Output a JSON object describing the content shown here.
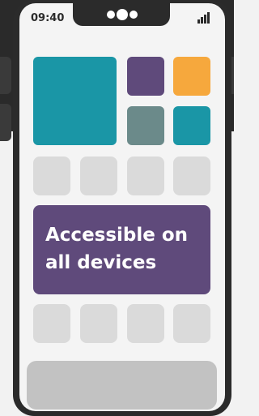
{
  "status_bar": {
    "time": "09:40",
    "signal_icon": "cellular-signal-icon",
    "notch_icon": "camera-notch-icon"
  },
  "tiles": {
    "large_color": "#1a96a6",
    "small_colors": [
      "#5f4a7b",
      "#f6a83d",
      "#6b8a8a",
      "#1a96a6"
    ]
  },
  "placeholder_color": "#dadada",
  "banner": {
    "text_line1": "Accessible on",
    "text_line2": "all devices",
    "color": "#5f4a7b"
  },
  "bottom_bar_color": "#c2c2c2"
}
